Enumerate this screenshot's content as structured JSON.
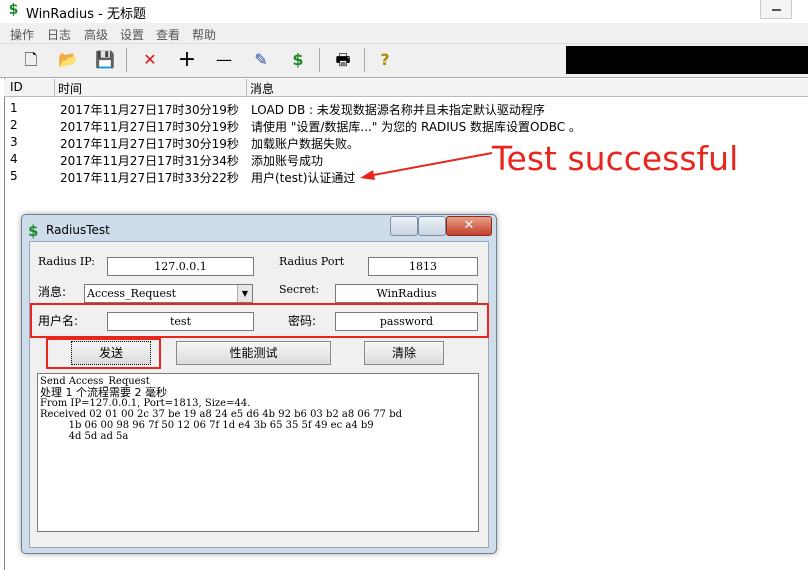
{
  "window": {
    "title": "WinRadius - 无标题"
  },
  "menu": [
    "操作",
    "日志",
    "高级",
    "设置",
    "查看",
    "帮助"
  ],
  "toolbar": [
    {
      "name": "new-icon",
      "glyph": "🗋"
    },
    {
      "name": "open-icon",
      "glyph": "📂"
    },
    {
      "name": "save-icon",
      "glyph": "💾"
    },
    {
      "name": "delete-icon",
      "glyph": "✕"
    },
    {
      "name": "add-icon",
      "glyph": "+"
    },
    {
      "name": "remove-icon",
      "glyph": "—"
    },
    {
      "name": "edit-icon",
      "glyph": "✎"
    },
    {
      "name": "dollar-icon",
      "glyph": "$"
    },
    {
      "name": "print-icon",
      "glyph": "🖶"
    },
    {
      "name": "help-icon",
      "glyph": "?"
    }
  ],
  "list": {
    "columns": [
      "ID",
      "时间",
      "消息"
    ],
    "rows": [
      {
        "id": "1",
        "time": "2017年11月27日17时30分19秒",
        "msg": "LOAD DB : 未发现数据源名称并且未指定默认驱动程序"
      },
      {
        "id": "2",
        "time": "2017年11月27日17时30分19秒",
        "msg": "请使用 \"设置/数据库...\" 为您的 RADIUS 数据库设置ODBC 。"
      },
      {
        "id": "3",
        "time": "2017年11月27日17时30分19秒",
        "msg": "加载账户数据失败。"
      },
      {
        "id": "4",
        "time": "2017年11月27日17时31分34秒",
        "msg": "添加账号成功"
      },
      {
        "id": "5",
        "time": "2017年11月27日17时33分22秒",
        "msg": "用户(test)认证通过"
      }
    ]
  },
  "annotation": {
    "text": "Test successful",
    "color": "#e8261d"
  },
  "dialog": {
    "title": "RadiusTest",
    "radius_ip_label": "Radius IP:",
    "radius_ip": "127.0.0.1",
    "radius_port_label": "Radius Port",
    "radius_port": "1813",
    "message_label": "消息:",
    "message_value": "Access_Request",
    "secret_label": "Secret:",
    "secret": "WinRadius",
    "username_label": "用户名:",
    "username": "test",
    "password_label": "密码:",
    "password": "password",
    "send_button": "发送",
    "perf_button": "性能测试",
    "clear_button": "清除",
    "output": [
      "Send Access_Request",
      "处理 1 个流程需要 2 毫秒",
      "From IP=127.0.0.1, Port=1813, Size=44.",
      "Received 02 01 00 2c 37 be 19 a8 24 e5 d6 4b 92 b6 03 b2 a8 06 77 bd",
      "         1b 06 00 98 96 7f 50 12 06 7f 1d e4 3b 65 35 5f 49 ec a4 b9",
      "         4d 5d ad 5a"
    ]
  }
}
